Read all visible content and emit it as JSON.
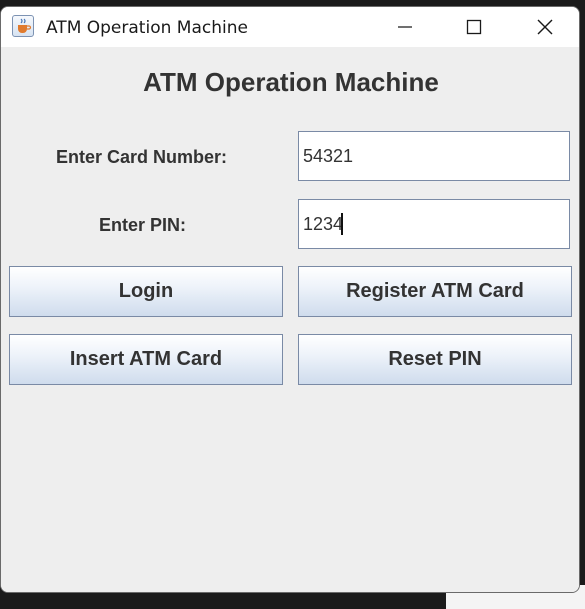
{
  "window": {
    "title": "ATM Operation Machine",
    "icon": "java-cup-icon",
    "controls": {
      "minimize_icon": "minimize-icon",
      "maximize_icon": "maximize-icon",
      "close_icon": "close-icon"
    }
  },
  "main": {
    "heading": "ATM Operation Machine",
    "card_number": {
      "label": "Enter Card Number:",
      "value": "54321"
    },
    "pin": {
      "label": "Enter PIN:",
      "value": "1234"
    },
    "buttons": {
      "login": "Login",
      "register": "Register ATM Card",
      "insert": "Insert ATM Card",
      "reset": "Reset PIN"
    }
  },
  "colors": {
    "window_bg": "#eeeeee",
    "titlebar_bg": "#ffffff",
    "text": "#333333",
    "button_border": "#7a8aa5",
    "button_gradient_bottom": "#cfdced"
  }
}
